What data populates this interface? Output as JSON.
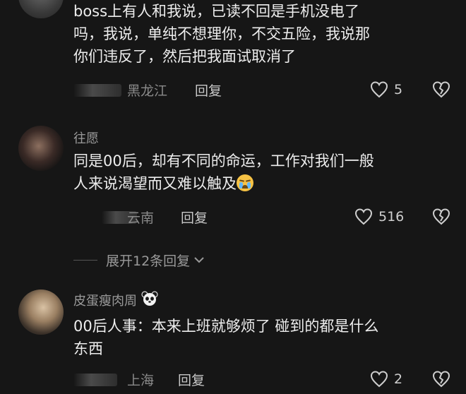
{
  "comments": [
    {
      "text_lines": [
        "boss上有人和我说，已读不回是手机没电了",
        "吗，我说，单纯不想理你，不交五险，我说那",
        "你们违反了，然后把我面试取消了"
      ],
      "location": "黑龙江",
      "reply_label": "回复",
      "likes": "5"
    },
    {
      "username": "往愿",
      "text_lines": [
        "同是00后，却有不同的命运，工作对我们一般",
        "人来说渴望而又难以触及"
      ],
      "emoji": "loudly-crying-face",
      "location": "云南",
      "reply_label": "回复",
      "likes": "516"
    },
    {
      "username": "皮蛋瘦肉周",
      "username_emoji": "panda-face",
      "text_lines": [
        "00后人事：本来上班就够烦了 碰到的都是什么",
        "东西"
      ],
      "location": "上海",
      "reply_label": "回复",
      "likes": "2"
    }
  ],
  "expand_replies": "展开12条回复",
  "colors": {
    "background": "#161616",
    "text": "#ededed",
    "muted": "#8a8a8a"
  }
}
